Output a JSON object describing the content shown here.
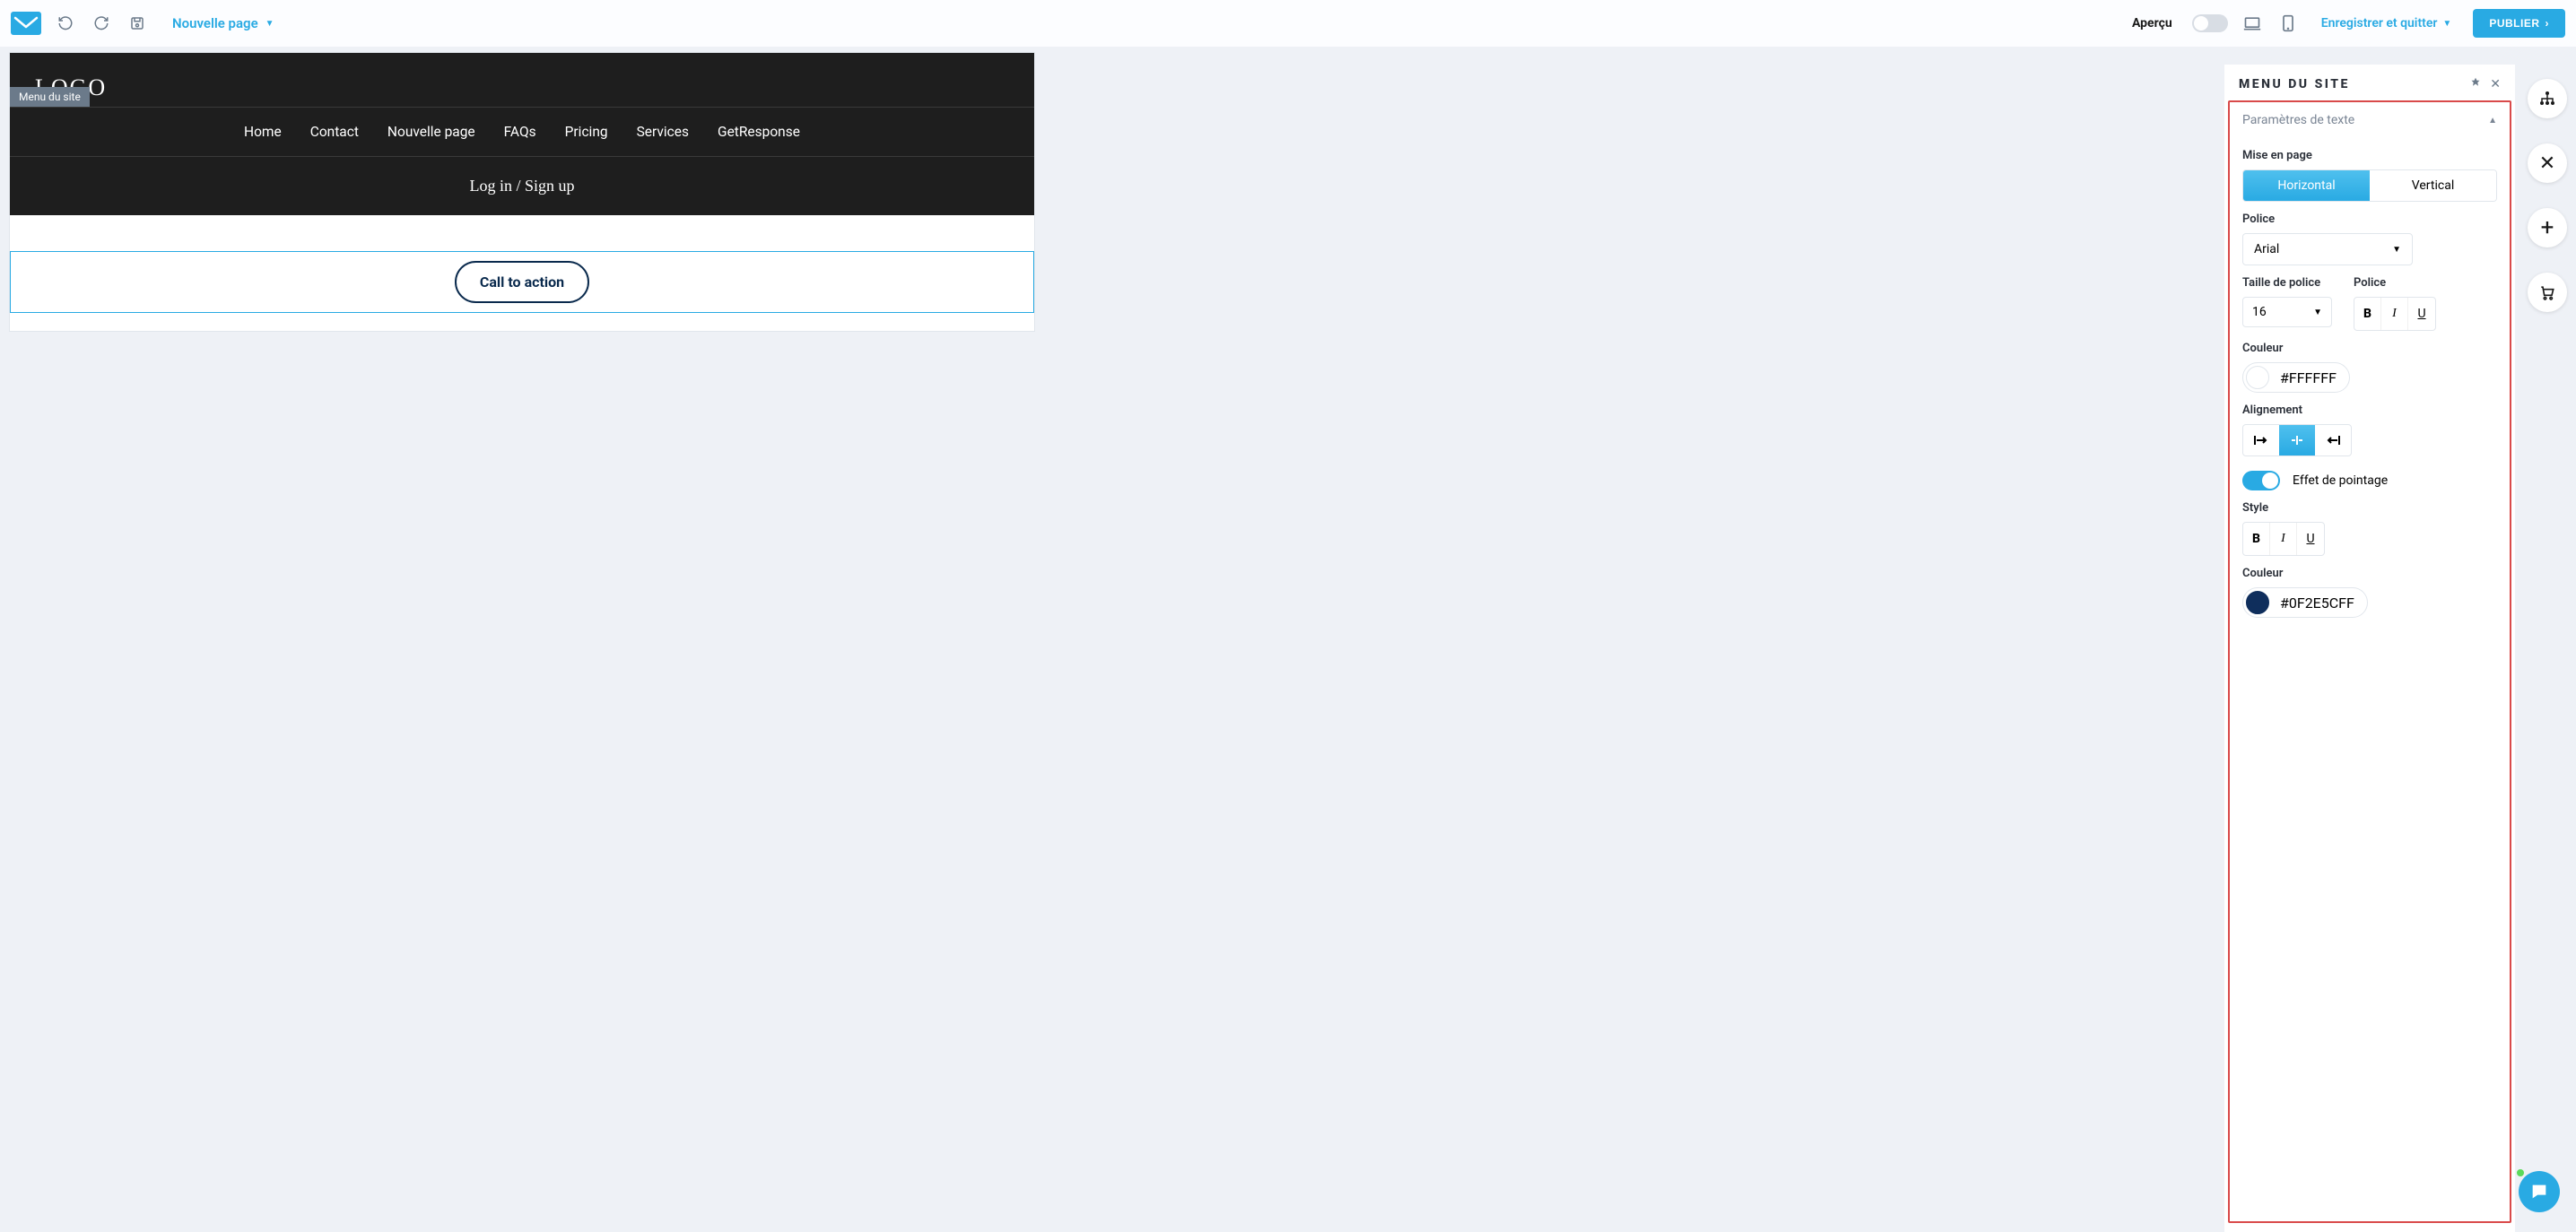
{
  "topbar": {
    "page_dropdown": "Nouvelle page",
    "preview_label": "Aperçu",
    "save_exit": "Enregistrer et quitter",
    "publish": "PUBLIER"
  },
  "canvas": {
    "logo_text": "LOGO",
    "site_menu_tag": "Menu du site",
    "nav": [
      "Home",
      "Contact",
      "Nouvelle page",
      "FAQs",
      "Pricing",
      "Services",
      "GetResponse"
    ],
    "login_text": "Log in / Sign up",
    "cta": "Call to action"
  },
  "panel": {
    "title": "MENU DU SITE",
    "section": "Paramètres de texte",
    "layout_label": "Mise en page",
    "layout_options": [
      "Horizontal",
      "Vertical"
    ],
    "font_label": "Police",
    "font_value": "Arial",
    "font_size_label": "Taille de police",
    "font_style_label": "Police",
    "font_size_value": "16",
    "color_label": "Couleur",
    "color_value": "#FFFFFF",
    "alignment_label": "Alignement",
    "hover_label": "Effet de pointage",
    "style_label": "Style",
    "hover_color_label": "Couleur",
    "hover_color_value": "#0F2E5CFF"
  },
  "colors": {
    "accent": "#29aae3",
    "navy": "#0f2e5c"
  }
}
